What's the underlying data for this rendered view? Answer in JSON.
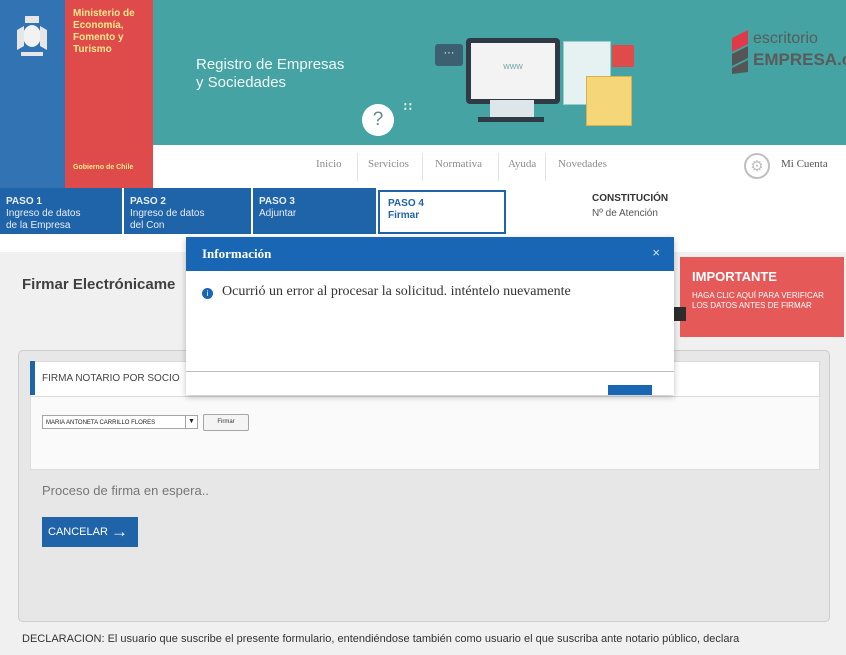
{
  "header": {
    "ministry": "Ministerio de\nEconomía,\nFomento y\nTurismo",
    "government": "Gobierno de Chile",
    "registry_title": "Registro de Empresas\ny Sociedades",
    "help_glyph": "?",
    "monitor_text": "www",
    "logo_line1": "escritorio",
    "logo_line2": "EMPRESA.cl"
  },
  "nav": {
    "items": [
      "Inicio",
      "Servicios",
      "Normativa",
      "Ayuda",
      "Novedades"
    ],
    "account": "Mi Cuenta"
  },
  "steps": [
    {
      "title": "PASO 1",
      "desc": "Ingreso de datos\nde la Empresa"
    },
    {
      "title": "PASO 2",
      "desc": "Ingreso de datos\ndel Con"
    },
    {
      "title": "PASO 3",
      "desc": "Adjuntar"
    },
    {
      "title": "PASO 4",
      "desc": "Firmar"
    }
  ],
  "status": {
    "constitucion": "CONSTITUCIÓN",
    "atencion": "Nº de Atención"
  },
  "page": {
    "title": "Firmar Electrónicame",
    "important_title": "IMPORTANTE",
    "important_body": "HAGA CLIC AQUÍ PARA VERIFICAR LOS DATOS ANTES DE FIRMAR",
    "section_label": "FIRMA NOTARIO POR SOCIO",
    "select_value": "MARIA ANTONETA CARRILLO FLORES",
    "sign_button": "Firmar",
    "process_status": "Proceso de firma en espera..",
    "cancel_button": "CANCELAR",
    "declaration": "DECLARACION: El usuario que suscribe el presente formulario, entendiéndose también como usuario el que suscriba ante notario público, declara"
  },
  "modal": {
    "title": "Información",
    "close": "×",
    "message": "Ocurrió un error al procesar la solicitud. inténtelo nuevamente"
  },
  "colors": {
    "teal": "#45a3a3",
    "blue": "#1f63a8",
    "red": "#df4a4a",
    "modal_blue": "#1966b5"
  }
}
